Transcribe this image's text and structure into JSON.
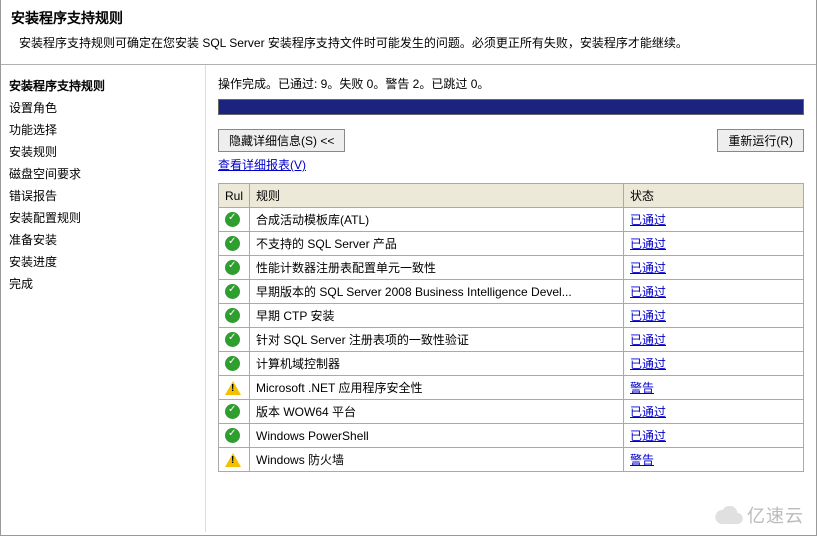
{
  "header": {
    "title": "安装程序支持规则",
    "desc": "安装程序支持规则可确定在您安装 SQL Server 安装程序支持文件时可能发生的问题。必须更正所有失败，安装程序才能继续。"
  },
  "sidebar": {
    "items": [
      {
        "label": "安装程序支持规则",
        "active": true
      },
      {
        "label": "设置角色",
        "active": false
      },
      {
        "label": "功能选择",
        "active": false
      },
      {
        "label": "安装规则",
        "active": false
      },
      {
        "label": "磁盘空间要求",
        "active": false
      },
      {
        "label": "错误报告",
        "active": false
      },
      {
        "label": "安装配置规则",
        "active": false
      },
      {
        "label": "准备安装",
        "active": false
      },
      {
        "label": "安装进度",
        "active": false
      },
      {
        "label": "完成",
        "active": false
      }
    ]
  },
  "main": {
    "status": "操作完成。已通过: 9。失败 0。警告 2。已跳过 0。",
    "hide_details_btn": "隐藏详细信息(S) <<",
    "rerun_btn": "重新运行(R)",
    "view_report_link": "查看详细报表(V)",
    "table": {
      "col_icon": "Rul",
      "col_rule": "规则",
      "col_status": "状态",
      "rows": [
        {
          "icon": "pass",
          "rule": "合成活动模板库(ATL)",
          "status": "已通过"
        },
        {
          "icon": "pass",
          "rule": "不支持的 SQL Server 产品",
          "status": "已通过"
        },
        {
          "icon": "pass",
          "rule": "性能计数器注册表配置单元一致性",
          "status": "已通过"
        },
        {
          "icon": "pass",
          "rule": "早期版本的 SQL Server 2008 Business Intelligence Devel...",
          "status": "已通过"
        },
        {
          "icon": "pass",
          "rule": "早期 CTP 安装",
          "status": "已通过"
        },
        {
          "icon": "pass",
          "rule": "针对 SQL Server 注册表项的一致性验证",
          "status": "已通过"
        },
        {
          "icon": "pass",
          "rule": "计算机域控制器",
          "status": "已通过"
        },
        {
          "icon": "warn",
          "rule": "Microsoft .NET 应用程序安全性",
          "status": "警告"
        },
        {
          "icon": "pass",
          "rule": "版本 WOW64 平台",
          "status": "已通过"
        },
        {
          "icon": "pass",
          "rule": "Windows PowerShell",
          "status": "已通过"
        },
        {
          "icon": "warn",
          "rule": "Windows 防火墙",
          "status": "警告"
        }
      ]
    }
  },
  "watermark": "亿速云"
}
